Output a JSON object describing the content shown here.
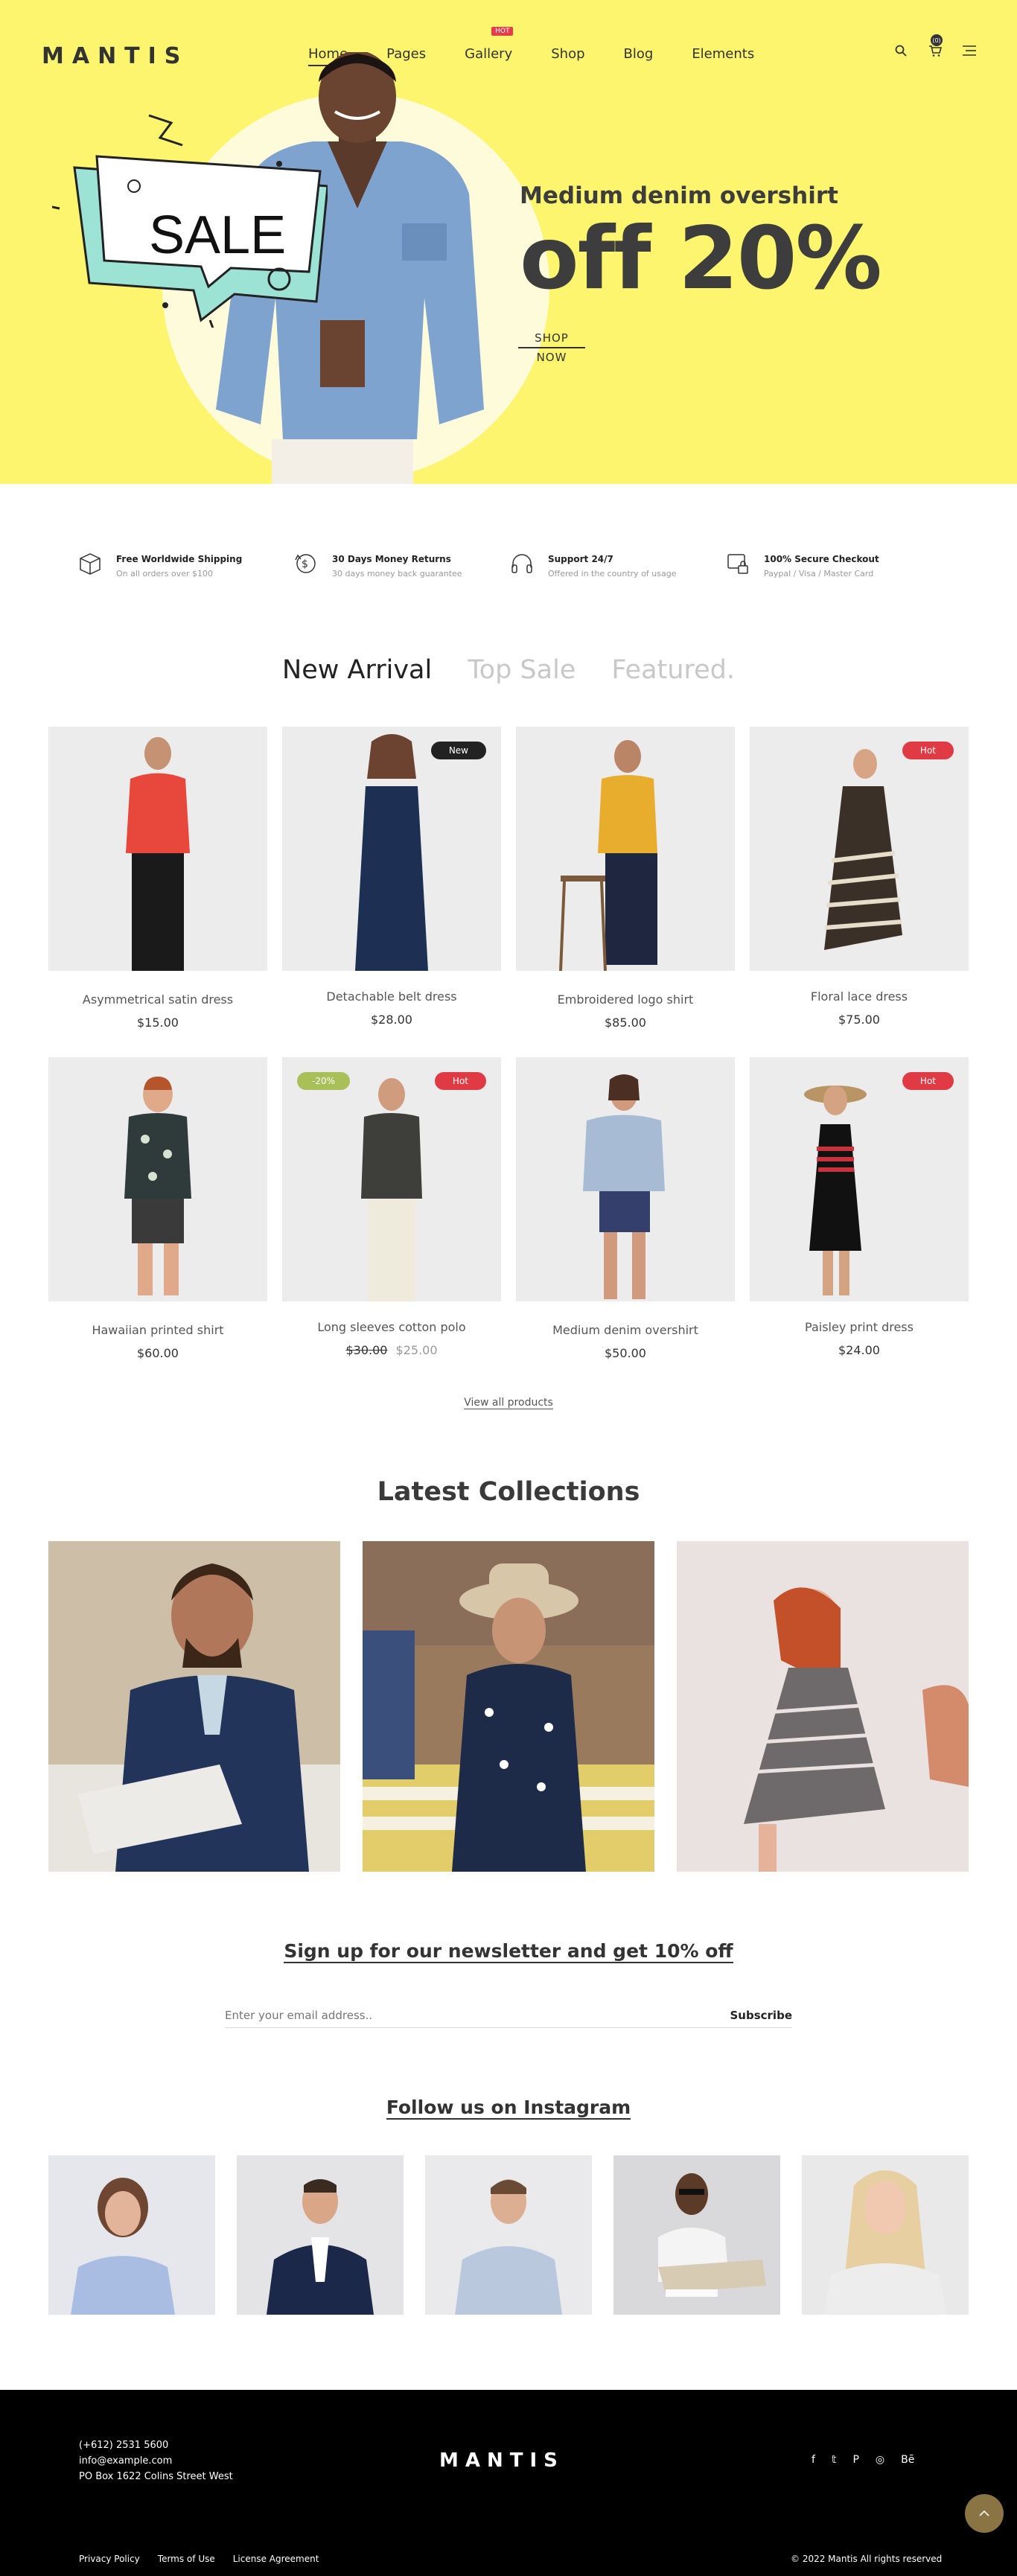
{
  "brand": {
    "name": "MANTIS"
  },
  "nav": {
    "items": [
      {
        "label": "Home",
        "active": true
      },
      {
        "label": "Pages"
      },
      {
        "label": "Gallery",
        "badge": "HOT"
      },
      {
        "label": "Shop"
      },
      {
        "label": "Blog"
      },
      {
        "label": "Elements"
      }
    ],
    "icons": [
      "search-icon",
      "cart-icon",
      "menu-icon"
    ],
    "cart_count": "(0)"
  },
  "hero": {
    "bubble_text": "SALE",
    "subtitle": "Medium denim overshirt",
    "title": "off 20%",
    "cta_line1": "SHOP",
    "cta_line2": "NOW",
    "background": "#fdf56d"
  },
  "features": [
    {
      "icon": "box-icon",
      "title": "Free Worldwide Shipping",
      "sub": "On all orders over $100"
    },
    {
      "icon": "returns-icon",
      "title": "30 Days Money Returns",
      "sub": "30 days money back guarantee"
    },
    {
      "icon": "headphones-icon",
      "title": "Support 24/7",
      "sub": "Offered in the country of usage"
    },
    {
      "icon": "secure-checkout-icon",
      "title": "100% Secure Checkout",
      "sub": "Paypal / Visa / Master Card"
    }
  ],
  "tabs": [
    {
      "label": "New Arrival",
      "active": true
    },
    {
      "label": "Top Sale"
    },
    {
      "label": "Featured."
    }
  ],
  "products": [
    {
      "name": "Asymmetrical satin dress",
      "price": "$15.00"
    },
    {
      "name": "Detachable belt dress",
      "price": "$28.00",
      "badge": "New"
    },
    {
      "name": "Embroidered logo shirt",
      "price": "$85.00"
    },
    {
      "name": "Floral lace dress",
      "price": "$75.00",
      "badge": "Hot"
    },
    {
      "name": "Hawaiian printed shirt",
      "price": "$60.00"
    },
    {
      "name": "Long sleeves cotton polo",
      "price_old": "$30.00",
      "price_new": "$25.00",
      "badge": "Hot",
      "discount": "-20%"
    },
    {
      "name": "Medium denim overshirt",
      "price": "$50.00"
    },
    {
      "name": "Paisley print dress",
      "price": "$24.00",
      "badge": "Hot"
    }
  ],
  "badge_colors": {
    "New": "#222222",
    "Hot": "#e03b45",
    "discount": "#a9bf58"
  },
  "view_all": "View all products",
  "collections": {
    "title": "Latest Collections"
  },
  "newsletter": {
    "title": "Sign up for our newsletter and get 10% off",
    "placeholder": "Enter your email address..",
    "button": "Subscribe"
  },
  "instagram": {
    "title": "Follow us on Instagram"
  },
  "footer": {
    "phone": "(+612) 2531 5600",
    "email": "info@example.com",
    "address": "PO Box 1622 Colins Street West",
    "logo": "MANTIS",
    "social": [
      "f",
      "𝕥",
      "P",
      "◎",
      "Bē"
    ],
    "links": [
      "Privacy Policy",
      "Terms of Use",
      "License Agreement"
    ],
    "copyright": "© 2022 Mantis All rights reserved"
  }
}
